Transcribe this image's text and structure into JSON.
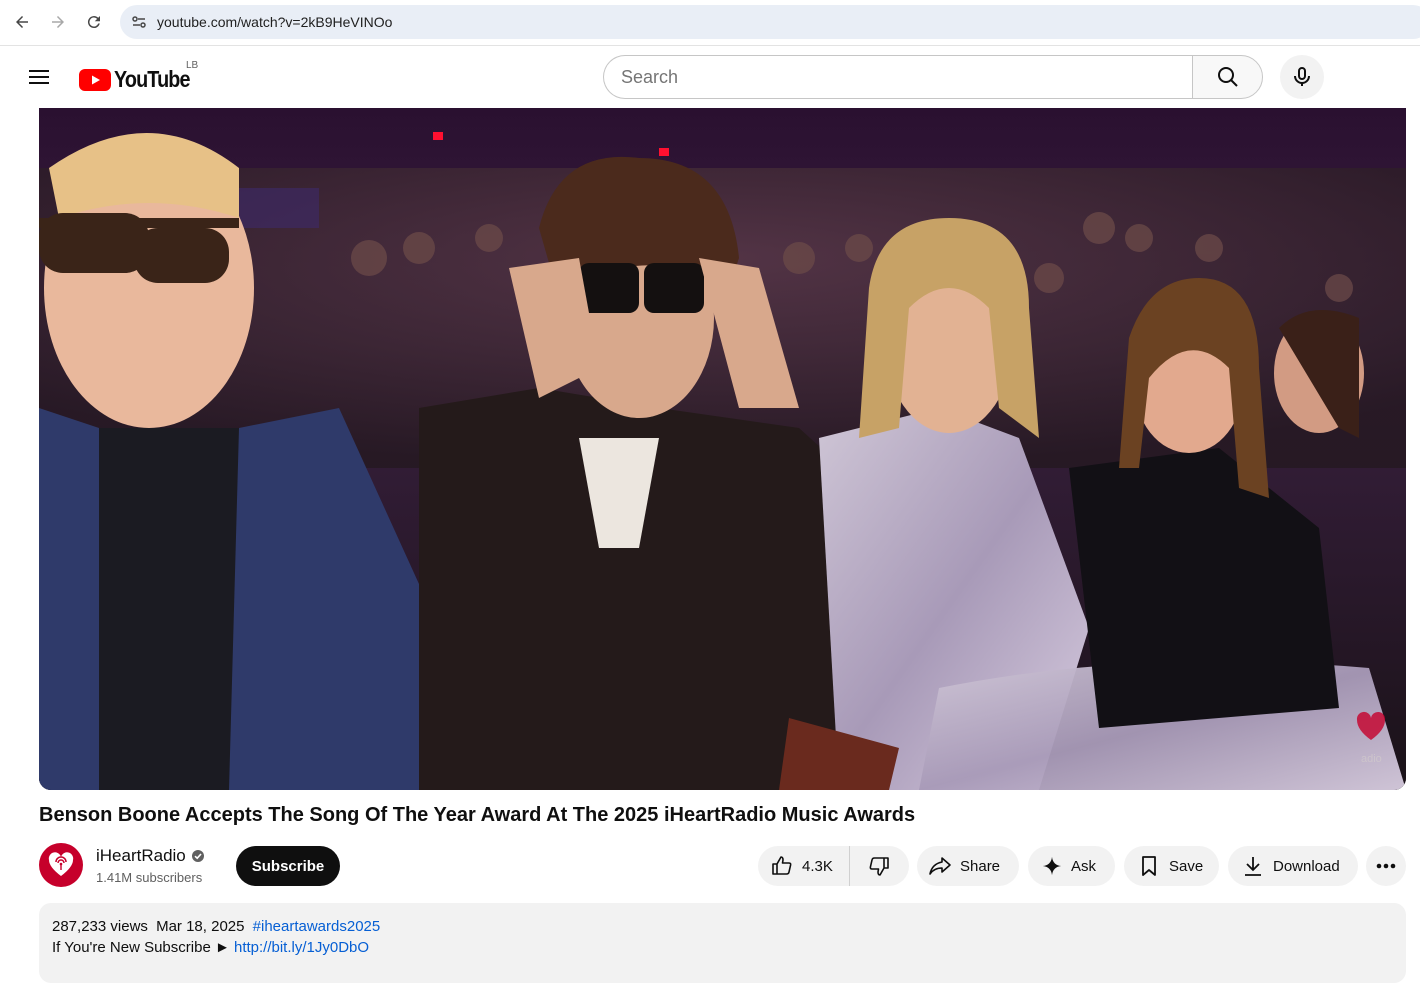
{
  "browser": {
    "url": "youtube.com/watch?v=2kB9HeVINOo"
  },
  "masthead": {
    "logo_text": "YouTube",
    "country_code": "LB",
    "search_placeholder": "Search"
  },
  "video": {
    "title": "Benson Boone Accepts The Song Of The Year Award At The 2025 iHeartRadio Music Awards",
    "watermark_text": "adio"
  },
  "owner": {
    "channel_name": "iHeartRadio",
    "subscribers": "1.41M subscribers",
    "subscribe_label": "Subscribe"
  },
  "actions": {
    "likes": "4.3K",
    "share": "Share",
    "ask": "Ask",
    "save": "Save",
    "download": "Download"
  },
  "description": {
    "views": "287,233 views",
    "date": "Mar 18, 2025",
    "hashtag": "#iheartawards2025",
    "line2_text": "If You're New Subscribe ►",
    "line2_link": "http://bit.ly/1Jy0DbO"
  },
  "colors": {
    "brand_red": "#ff0000",
    "iheart_red": "#c6002b",
    "link_blue": "#065fd4"
  }
}
